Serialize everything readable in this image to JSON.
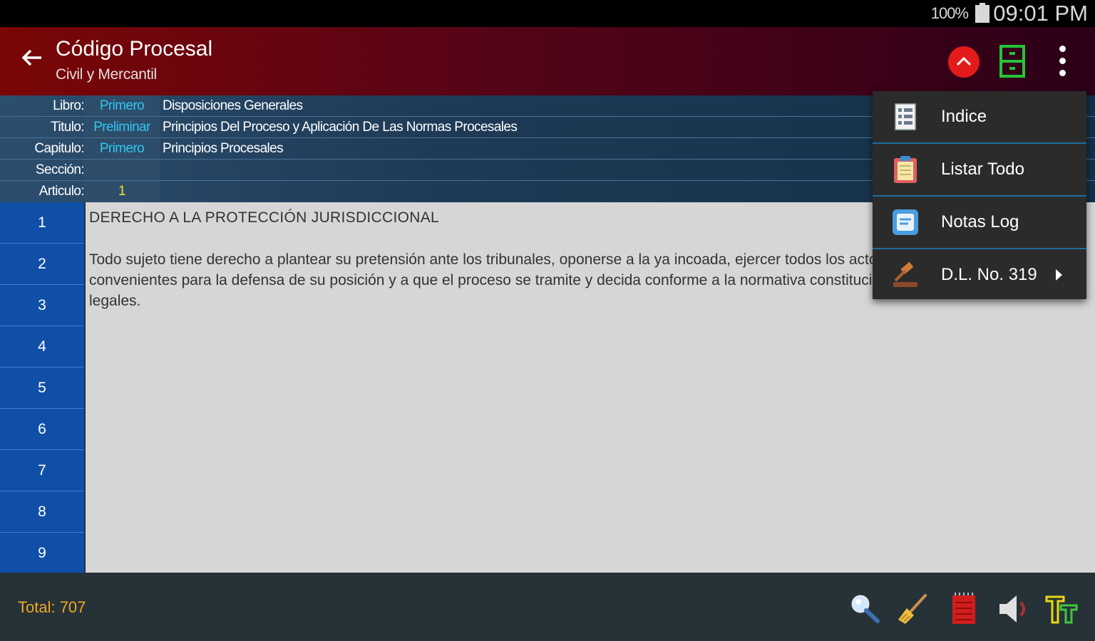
{
  "status": {
    "battery": "100%",
    "time": "09:01 PM"
  },
  "appbar": {
    "title": "Código Procesal",
    "subtitle": "Civil y Mercantil"
  },
  "info": [
    {
      "label": "Libro:",
      "value": "Primero",
      "desc": "Disposiciones Generales"
    },
    {
      "label": "Titulo:",
      "value": "Preliminar",
      "desc": "Principios Del Proceso y Aplicación De Las Normas Procesales"
    },
    {
      "label": "Capitulo:",
      "value": "Primero",
      "desc": "Principios Procesales"
    },
    {
      "label": "Sección:",
      "value": "",
      "desc": ""
    },
    {
      "label": "Articulo:",
      "value": "1",
      "desc": ""
    }
  ],
  "article_numbers": [
    "1",
    "2",
    "3",
    "4",
    "5",
    "6",
    "7",
    "8",
    "9"
  ],
  "article": {
    "title": "DERECHO A LA PROTECCIÓN JURISDICCIONAL",
    "body": "Todo sujeto tiene derecho a plantear su pretensión ante los tribunales, oponerse a la ya incoada, ejercer todos los actos procesales que estime convenientes para la defensa de su posición y a que el proceso se tramite y decida conforme a la normativa constitucional y a las disposiciones legales."
  },
  "menu": [
    {
      "label": "Indice",
      "icon": "index-list-icon"
    },
    {
      "label": "Listar Todo",
      "icon": "clipboard-icon"
    },
    {
      "label": "Notas Log",
      "icon": "notes-icon"
    },
    {
      "label": "D.L. No. 319",
      "icon": "gavel-icon",
      "submenu": true
    }
  ],
  "footer": {
    "total": "Total: 707"
  },
  "colors": {
    "accent": "#2fc6ef",
    "total": "#f0a81e",
    "number_column": "#0f4fa8",
    "appbar_start": "#7a0606"
  }
}
